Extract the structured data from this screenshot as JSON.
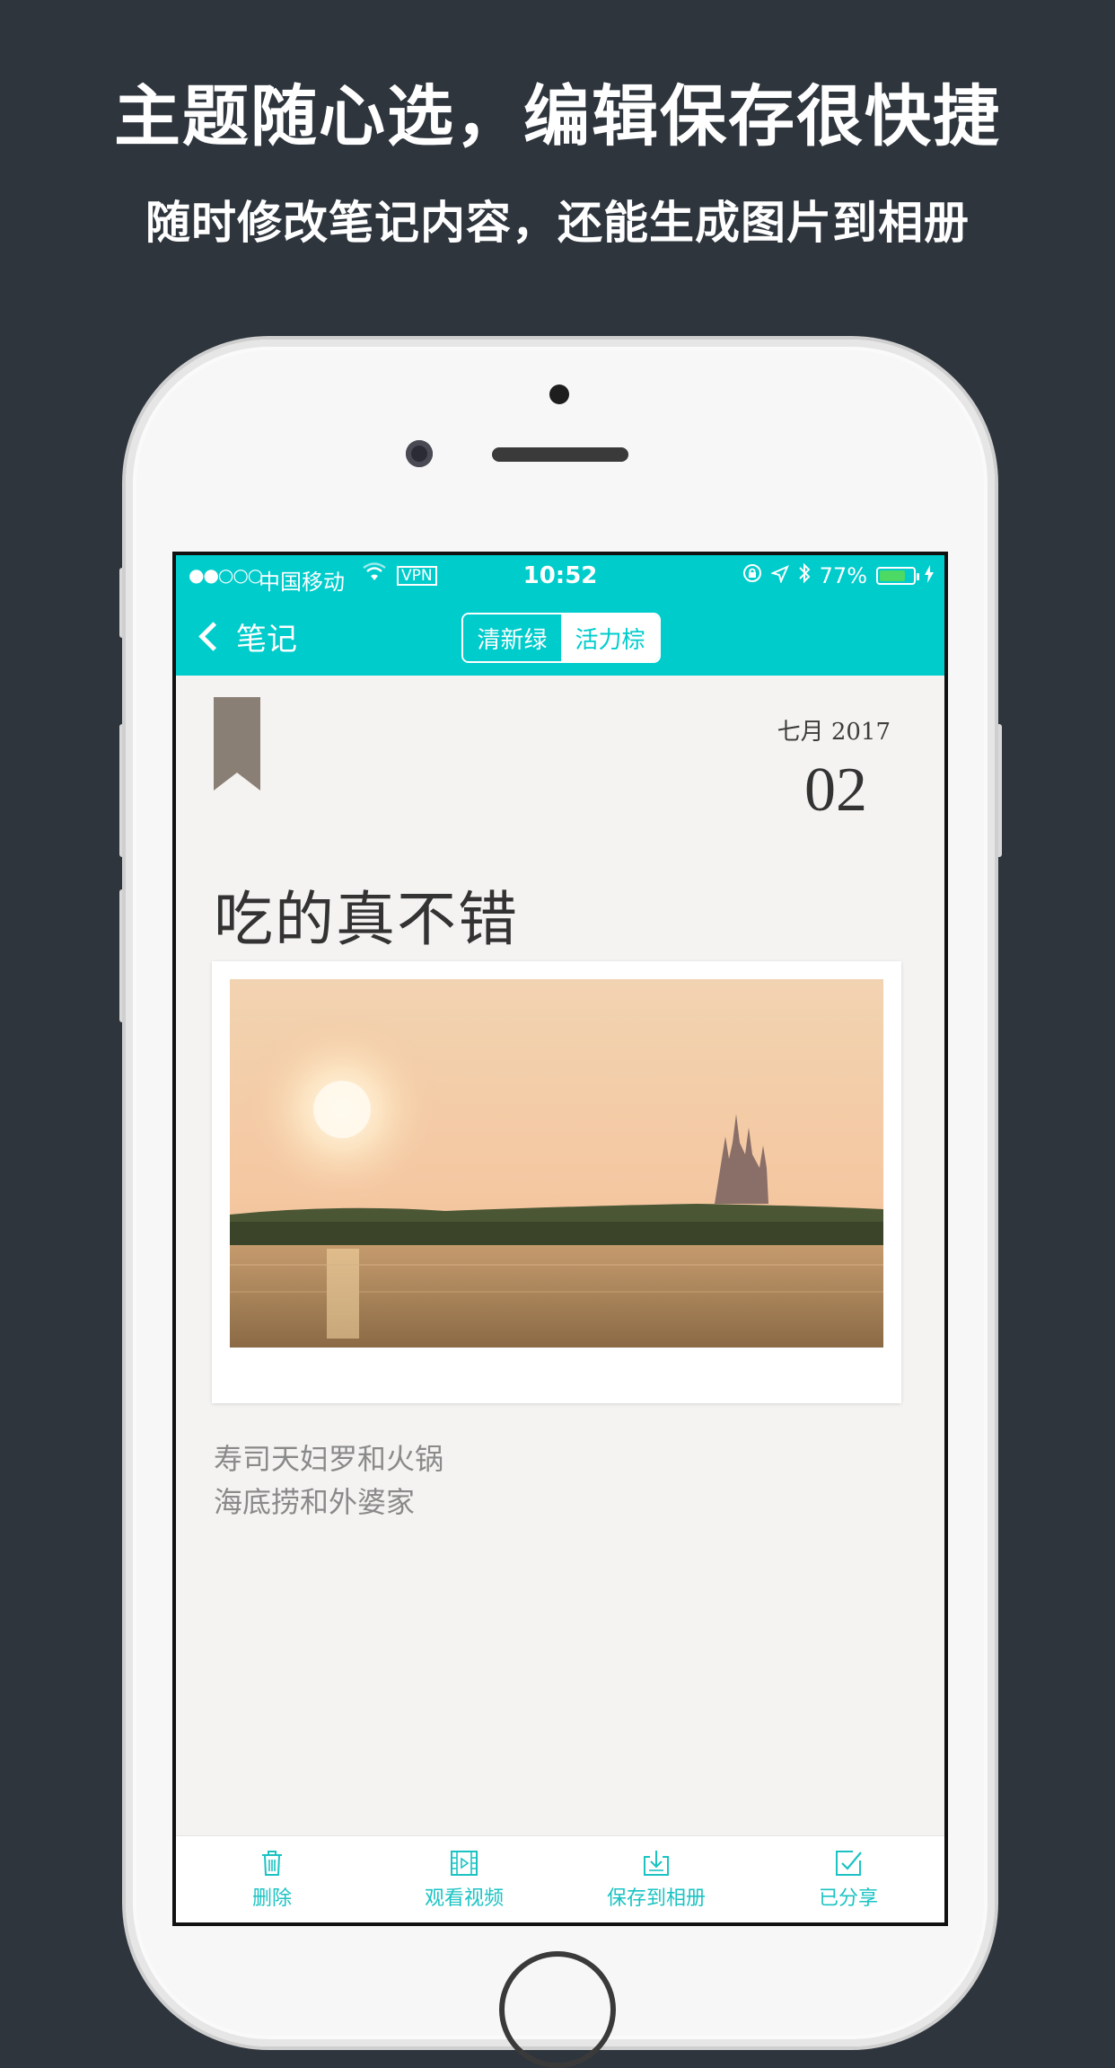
{
  "promo": {
    "headline": "主题随心选，编辑保存很快捷",
    "subline": "随时修改笔记内容，还能生成图片到相册"
  },
  "status_bar": {
    "signal": "●●○○○",
    "carrier": "中国移动",
    "wifi": "wifi-icon",
    "vpn": "VPN",
    "time": "10:52",
    "battery_text": "77%",
    "battery_level": 0.77,
    "icons": [
      "orientation-lock-icon",
      "location-arrow-icon",
      "bluetooth-icon",
      "charging-bolt-icon"
    ]
  },
  "nav": {
    "back_label": "笔记",
    "themes": [
      "清新绿",
      "活力棕"
    ],
    "selected_theme": "清新绿"
  },
  "note": {
    "month_year": "七月 2017",
    "day": "02",
    "title": "吃的真不错",
    "body_lines": [
      "寿司天妇罗和火锅",
      "海底捞和外婆家"
    ],
    "photo": "sunset-castle-lake-photo"
  },
  "toolbar": {
    "items": [
      {
        "label": "删除",
        "icon": "trash-icon"
      },
      {
        "label": "观看视频",
        "icon": "film-icon"
      },
      {
        "label": "保存到相册",
        "icon": "download-icon"
      },
      {
        "label": "已分享",
        "icon": "check-share-icon"
      }
    ]
  },
  "colors": {
    "accent": "#00cccc",
    "background": "#2e353d",
    "note_bg": "#f4f3f1",
    "bookmark": "#8a7f74"
  }
}
